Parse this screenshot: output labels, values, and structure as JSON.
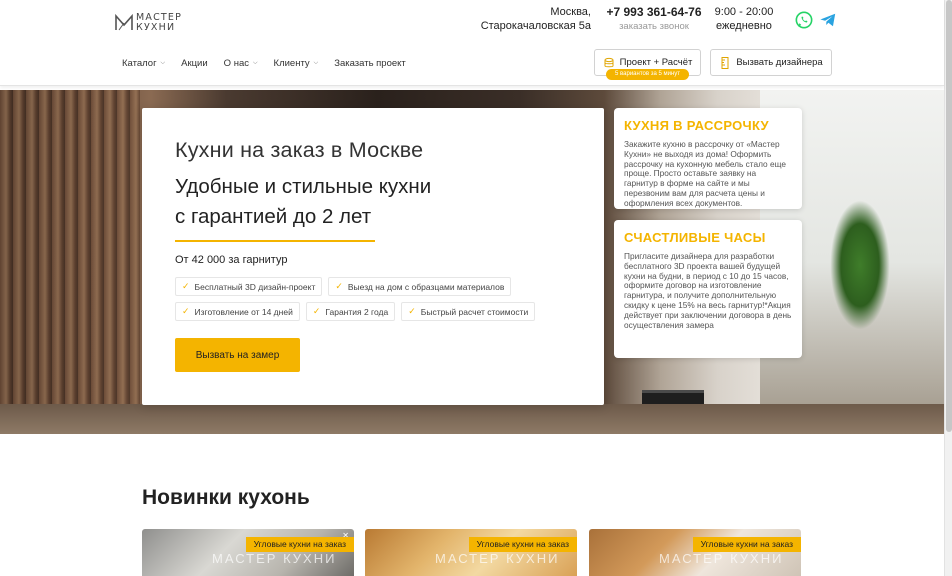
{
  "header": {
    "logo_line1": "МАСТЕР",
    "logo_line2": "КУХНИ",
    "address_line1": "Москва,",
    "address_line2": "Старокачаловская 5а",
    "phone": "+7 993 361-64-76",
    "phone_sub": "заказать звонок",
    "hours_line1": "9:00 - 20:00",
    "hours_line2": "ежедневно",
    "nav": [
      {
        "label": "Каталог",
        "has_dropdown": true
      },
      {
        "label": "Акции",
        "has_dropdown": false
      },
      {
        "label": "О нас",
        "has_dropdown": true
      },
      {
        "label": "Клиенту",
        "has_dropdown": true
      },
      {
        "label": "Заказать проект",
        "has_dropdown": false
      }
    ],
    "btn_project": "Проект + Расчёт",
    "btn_project_badge": "5 вариантов за 5 минут",
    "btn_designer": "Вызвать дизайнера"
  },
  "hero": {
    "title": "Кухни на заказ в Москве",
    "subtitle_line1": "Удобные и стильные кухни",
    "subtitle_line2": "с гарантией до 2 лет",
    "price": "От 42 000 за гарнитур",
    "chips_row1": [
      "Бесплатный 3D дизайн-проект",
      "Выезд на дом с образцами материалов"
    ],
    "chips_row2": [
      "Изготовление от 14 дней",
      "Гарантия 2 года",
      "Быстрый расчет стоимости"
    ],
    "cta": "Вызвать на замер"
  },
  "promos": [
    {
      "title": "КУХНЯ В РАССРОЧКУ",
      "text": "Закажите кухню в рассрочку от «Мастер Кухни» не выходя из дома! Оформить рассрочку на кухонную мебель стало еще проще. Просто оставьте заявку на гарнитур в форме на сайте и мы перезвоним вам для расчета цены и оформления всех документов."
    },
    {
      "title": "СЧАСТЛИВЫЕ ЧАСЫ",
      "text": "Пригласите дизайнера для разработки бесплатного 3D проекта вашей будущей кухни на будни, в период с 10 до 15 часов, оформите договор на изготовление гарнитура, и получите дополнительную скидку к цене 15% на весь гарнитур!*Акция действует при заключении договора в день осуществления замера"
    }
  ],
  "new_section": {
    "title": "Новинки кухонь",
    "cards": [
      {
        "tag": "Угловые кухни на заказ",
        "watermark": "МАСТЕР КУХНИ"
      },
      {
        "tag": "Угловые кухни на заказ",
        "watermark": "МАСТЕР КУХНИ"
      },
      {
        "tag": "Угловые кухни на заказ",
        "watermark": "МАСТЕР КУХНИ"
      }
    ]
  },
  "colors": {
    "accent": "#f4b400",
    "whatsapp": "#25d366",
    "telegram": "#2aa3e0"
  }
}
